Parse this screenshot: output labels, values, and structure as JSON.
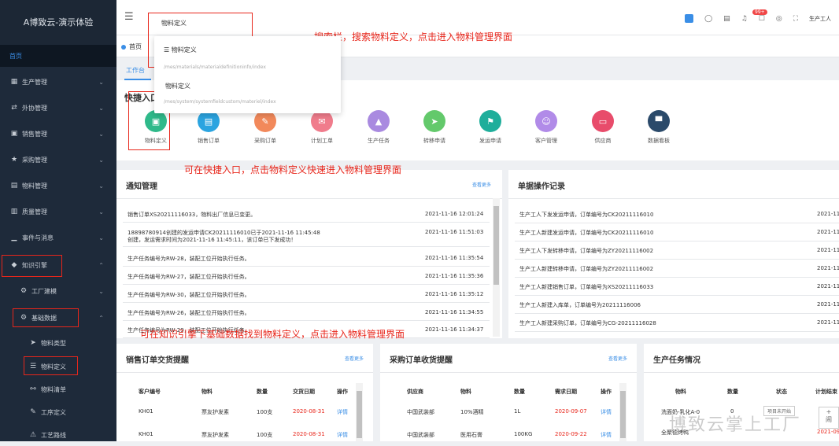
{
  "app_title": "A博致云-演示体验",
  "sidebar": {
    "home": "首页",
    "items": [
      {
        "label": "生产管理",
        "icon": "grid-icon"
      },
      {
        "label": "外协管理",
        "icon": "switch-icon"
      },
      {
        "label": "销售管理",
        "icon": "sales-icon"
      },
      {
        "label": "采购管理",
        "icon": "star-icon"
      },
      {
        "label": "物料管理",
        "icon": "table-icon"
      },
      {
        "label": "质量管理",
        "icon": "quality-icon"
      },
      {
        "label": "事件与消息",
        "icon": "bar-icon"
      },
      {
        "label": "知识引擎",
        "icon": "grad-cap-icon"
      },
      {
        "label": "工厂建模",
        "icon": "gear-icon"
      },
      {
        "label": "基础数据",
        "icon": "gear-icon"
      },
      {
        "label": "物料类型",
        "icon": "plane-icon"
      },
      {
        "label": "物料定义",
        "icon": "list-icon"
      },
      {
        "label": "物料清单",
        "icon": "link-icon"
      },
      {
        "label": "工序定义",
        "icon": "pin-icon"
      },
      {
        "label": "工艺路线",
        "icon": "route-icon"
      }
    ]
  },
  "topbar": {
    "search_value": "物料定义",
    "badge": "99+",
    "user": "生产工人"
  },
  "tabs": {
    "home": "首页",
    "sub": "工作台"
  },
  "dropdown": {
    "items": [
      {
        "label": "物料定义",
        "path": "/mes/materials/materialdefinitioninfo/index"
      },
      {
        "label": "物料定义",
        "path": "/mes/system/systemfieldcustom/materiel/index"
      }
    ]
  },
  "quick": {
    "title": "快捷入口",
    "items": [
      {
        "label": "物料定义",
        "color": "#2fb98a"
      },
      {
        "label": "销售订单",
        "color": "#2ba4e0"
      },
      {
        "label": "采购订单",
        "color": "#f2895b"
      },
      {
        "label": "计划工单",
        "color": "#f07c8c"
      },
      {
        "label": "生产任务",
        "color": "#a98ae0"
      },
      {
        "label": "转移申请",
        "color": "#63c96b"
      },
      {
        "label": "发运申请",
        "color": "#1fae9b"
      },
      {
        "label": "客户管理",
        "color": "#b18be8"
      },
      {
        "label": "供应商",
        "color": "#e84c6b"
      },
      {
        "label": "数据看板",
        "color": "#2b4a6a"
      }
    ]
  },
  "notice": {
    "title": "通知管理",
    "more": "查看更多",
    "rows": [
      {
        "text": "销售订单XS20211116033，物料出厂信息已变更。",
        "time": "2021-11-16 12:01:24"
      },
      {
        "text": "18898780914创建的发运申请CK20211116010已于2021-11-16 11:45:48",
        "text2": "创建，发运需求时间为2021-11-16 11:45:11，该订单已下发成功！",
        "time": "2021-11-16 11:51:03"
      },
      {
        "text": "生产任务编号为RW-28，装配工位开始执行任务。",
        "time": "2021-11-16 11:35:54"
      },
      {
        "text": "生产任务编号为RW-27，装配工位开始执行任务。",
        "time": "2021-11-16 11:35:36"
      },
      {
        "text": "生产任务编号为RW-30，装配工位开始执行任务。",
        "time": "2021-11-16 11:35:12"
      },
      {
        "text": "生产任务编号为RW-26，装配工位开始执行任务。",
        "time": "2021-11-16 11:34:55"
      },
      {
        "text": "生产任务编号为RW-29，装配工位开始执行任务。",
        "time": "2021-11-16 11:34:37"
      }
    ]
  },
  "log": {
    "title": "单据操作记录",
    "rows": [
      {
        "text": "生产工人下发发运申请，订单编号为CK20211116010",
        "time": "2021-11"
      },
      {
        "text": "生产工人新建发运申请，订单编号为CK20211116010",
        "time": "2021-11"
      },
      {
        "text": "生产工人下发转移申请，订单编号为ZY20211116002",
        "time": "2021-11"
      },
      {
        "text": "生产工人新建转移申请，订单编号为ZY20211116002",
        "time": "2021-11"
      },
      {
        "text": "生产工人新建销售订单，订单编号为XS20211116033",
        "time": "2021-11"
      },
      {
        "text": "生产工人新建入库单，订单编号为20211116006",
        "time": "2021-11"
      },
      {
        "text": "生产工人新建采购订单，订单编号为CG-20211116028",
        "time": "2021-11"
      }
    ]
  },
  "sales": {
    "title": "销售订单交货提醒",
    "more": "查看更多",
    "headers": [
      "客户编号",
      "物料",
      "数量",
      "交货日期",
      "操作"
    ],
    "rows": [
      [
        "KH01",
        "票友护发素",
        "100支",
        "2020-08-31",
        "详情"
      ],
      [
        "KH01",
        "票友护发素",
        "100支",
        "2020-08-31",
        "详情"
      ]
    ]
  },
  "purchase": {
    "title": "采购订单收货提醒",
    "more": "查看更多",
    "headers": [
      "供应商",
      "物料",
      "数量",
      "需求日期",
      "操作"
    ],
    "rows": [
      [
        "中国武装部",
        "10%酒精",
        "1L",
        "2020-09-07",
        "详情"
      ],
      [
        "中国武装部",
        "医用石膏",
        "100KG",
        "2020-09-22",
        "详情"
      ]
    ]
  },
  "production": {
    "title": "生产任务情况",
    "headers": [
      "物料",
      "数量",
      "状态",
      "计划结束"
    ],
    "rows": [
      [
        "洗面奶-乳化A-0",
        "0",
        "项目未开始",
        ""
      ],
      [
        "全聚德烤鸭",
        "",
        "",
        "2021-09"
      ]
    ],
    "btn1": "+",
    "btn2": "闹"
  },
  "annotations": {
    "a1": "搜索栏，搜索物料定义，点击进入物料管理界面",
    "a2": "可在快捷入口，点击物料定义快速进入物料管理界面",
    "a3": "可在知识引擎下基础数据找到物料定义，点击进入物料管理界面"
  },
  "watermark": "博致云掌上工厂",
  "colors": {
    "accent": "#3a8ee6",
    "annotation": "#e8261b",
    "sidebar": "#1e2a3a"
  }
}
